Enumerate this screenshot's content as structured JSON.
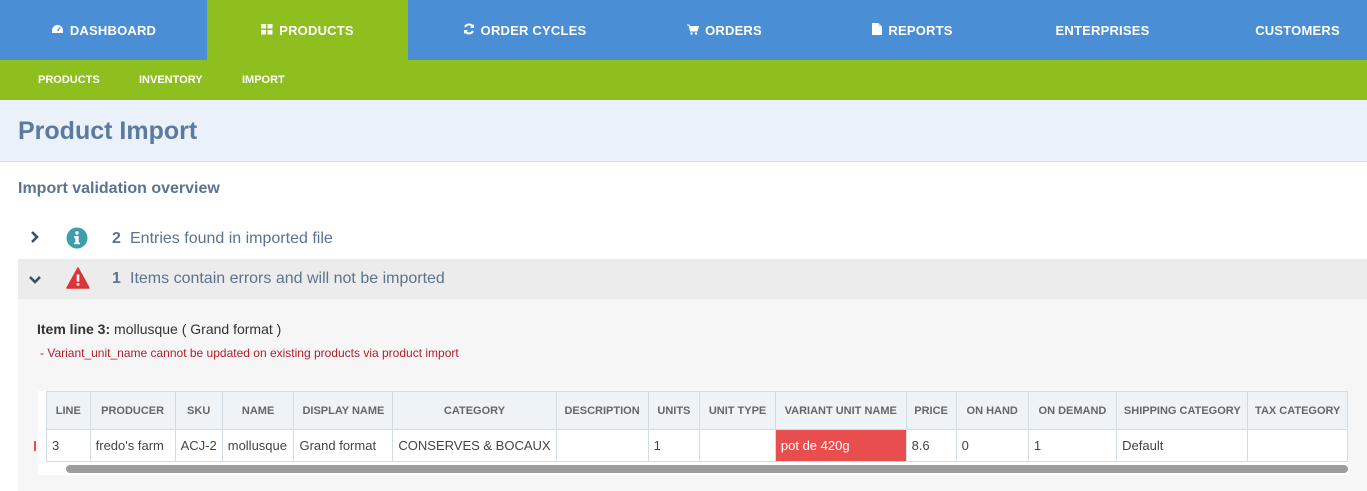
{
  "topnav": [
    {
      "label": "DASHBOARD",
      "icon": "dashboard-icon"
    },
    {
      "label": "PRODUCTS",
      "icon": "grid-icon"
    },
    {
      "label": "ORDER CYCLES",
      "icon": "refresh-icon"
    },
    {
      "label": "ORDERS",
      "icon": "cart-icon"
    },
    {
      "label": "REPORTS",
      "icon": "file-icon"
    },
    {
      "label": "ENTERPRISES"
    },
    {
      "label": "CUSTOMERS"
    }
  ],
  "subnav": [
    "PRODUCTS",
    "INVENTORY",
    "IMPORT"
  ],
  "page_title": "Product Import",
  "overview_title": "Import validation overview",
  "summary": [
    {
      "count": "2",
      "text": "Entries found in imported file",
      "icon": "info-icon"
    },
    {
      "count": "1",
      "text": "Items contain errors and will not be imported",
      "icon": "warning-icon"
    }
  ],
  "error_item": {
    "label": "Item line 3:",
    "value": " mollusque ( Grand format )",
    "message": "-  Variant_unit_name cannot be updated on existing products via product import"
  },
  "table": {
    "headers": [
      "LINE",
      "PRODUCER",
      "SKU",
      "NAME",
      "DISPLAY NAME",
      "CATEGORY",
      "DESCRIPTION",
      "UNITS",
      "UNIT TYPE",
      "VARIANT UNIT NAME",
      "PRICE",
      "ON HAND",
      "ON DEMAND",
      "SHIPPING CATEGORY",
      "TAX CATEGORY"
    ],
    "row": [
      "3",
      "fredo's farm",
      "ACJ-2",
      "mollusque",
      "Grand format",
      "CONSERVES & BOCAUX",
      "",
      "1",
      "",
      "pot de 420g",
      "8.6",
      "0",
      "1",
      "Default",
      ""
    ]
  },
  "colors": {
    "nav_blue": "#4a8fd6",
    "nav_green": "#8ebf1f",
    "error_red": "#e94e4e",
    "info_teal": "#3d9eae"
  }
}
